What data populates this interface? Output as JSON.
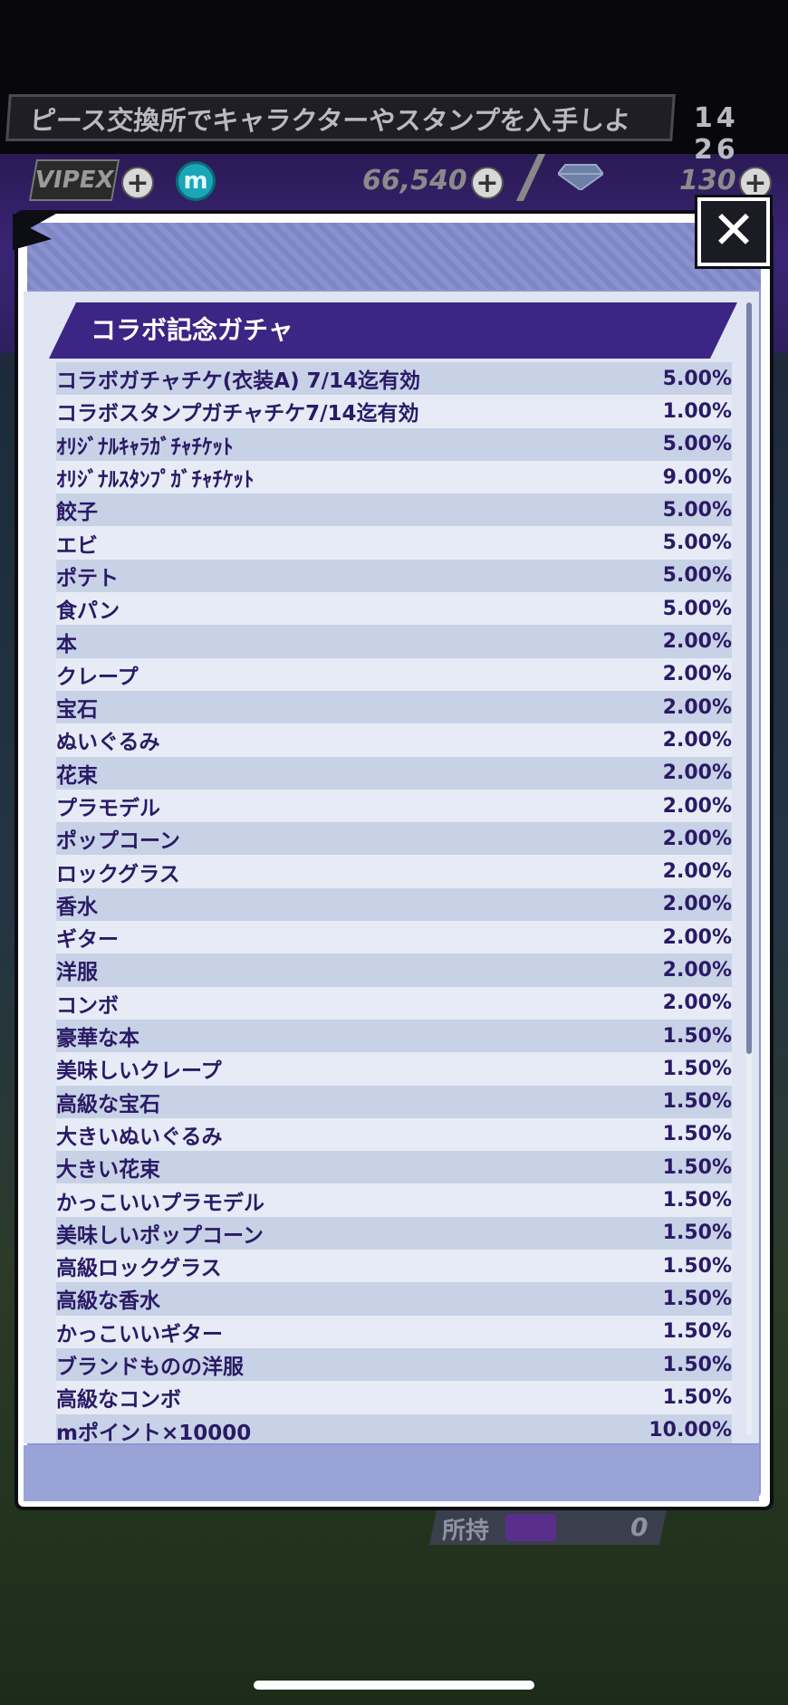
{
  "ticker": {
    "text": "ピース交換所でキャラクターやスタンプを入手しよ"
  },
  "clock": "14 26",
  "resources": {
    "vip_label": "VIPEX",
    "m_label": "m",
    "coins": "66,540",
    "gems": "130"
  },
  "close_label": "✕",
  "gacha": {
    "title": "コラボ記念ガチャ",
    "items": [
      {
        "name": "コラボガチャチケ(衣装A) 7/14迄有効",
        "rate": "5.00%"
      },
      {
        "name": "コラボスタンプガチャチケ7/14迄有効",
        "rate": "1.00%"
      },
      {
        "name": "ｵﾘｼﾞﾅﾙｷｬﾗｶﾞﾁｬﾁｹｯﾄ",
        "rate": "5.00%"
      },
      {
        "name": "ｵﾘｼﾞﾅﾙｽﾀﾝﾌﾟｶﾞﾁｬﾁｹｯﾄ",
        "rate": "9.00%"
      },
      {
        "name": "餃子",
        "rate": "5.00%"
      },
      {
        "name": "エビ",
        "rate": "5.00%"
      },
      {
        "name": "ポテト",
        "rate": "5.00%"
      },
      {
        "name": "食パン",
        "rate": "5.00%"
      },
      {
        "name": "本",
        "rate": "2.00%"
      },
      {
        "name": "クレープ",
        "rate": "2.00%"
      },
      {
        "name": "宝石",
        "rate": "2.00%"
      },
      {
        "name": "ぬいぐるみ",
        "rate": "2.00%"
      },
      {
        "name": "花束",
        "rate": "2.00%"
      },
      {
        "name": "プラモデル",
        "rate": "2.00%"
      },
      {
        "name": "ポップコーン",
        "rate": "2.00%"
      },
      {
        "name": "ロックグラス",
        "rate": "2.00%"
      },
      {
        "name": "香水",
        "rate": "2.00%"
      },
      {
        "name": "ギター",
        "rate": "2.00%"
      },
      {
        "name": "洋服",
        "rate": "2.00%"
      },
      {
        "name": "コンボ",
        "rate": "2.00%"
      },
      {
        "name": "豪華な本",
        "rate": "1.50%"
      },
      {
        "name": "美味しいクレープ",
        "rate": "1.50%"
      },
      {
        "name": "高級な宝石",
        "rate": "1.50%"
      },
      {
        "name": "大きいぬいぐるみ",
        "rate": "1.50%"
      },
      {
        "name": "大きい花束",
        "rate": "1.50%"
      },
      {
        "name": "かっこいいプラモデル",
        "rate": "1.50%"
      },
      {
        "name": "美味しいポップコーン",
        "rate": "1.50%"
      },
      {
        "name": "高級ロックグラス",
        "rate": "1.50%"
      },
      {
        "name": "高級な香水",
        "rate": "1.50%"
      },
      {
        "name": "かっこいいギター",
        "rate": "1.50%"
      },
      {
        "name": "ブランドものの洋服",
        "rate": "1.50%"
      },
      {
        "name": "高級なコンボ",
        "rate": "1.50%"
      },
      {
        "name": "mポイント×10000",
        "rate": "10.00%"
      }
    ]
  },
  "owned": {
    "label": "所持",
    "count": "0"
  },
  "colors": {
    "accent": "#3b2585",
    "text": "#2a1a66",
    "modal_bg": "#8f96cf"
  }
}
